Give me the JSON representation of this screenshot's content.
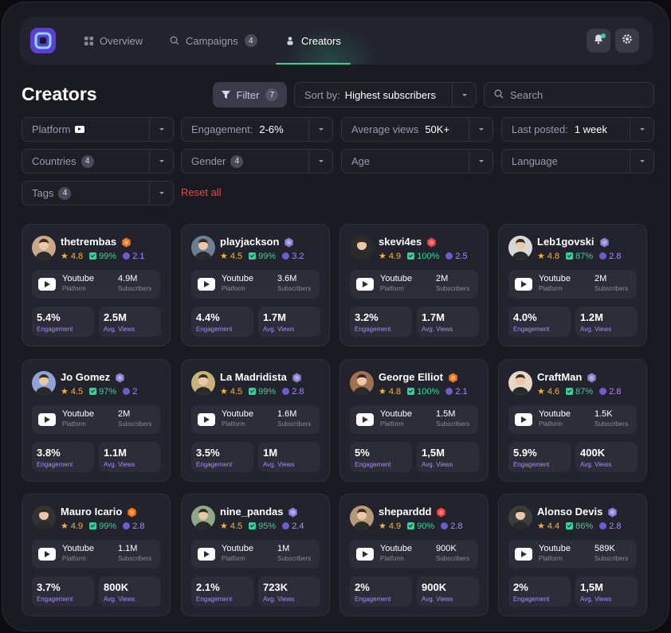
{
  "nav": {
    "tabs": [
      {
        "label": "Overview",
        "icon": "grid-icon"
      },
      {
        "label": "Campaigns",
        "count": "4",
        "icon": "search-icon"
      },
      {
        "label": "Creators",
        "icon": "creators-icon",
        "active": true
      }
    ],
    "accent": "#34d399"
  },
  "page_title": "Creators",
  "toolbar": {
    "filter_label": "Filter",
    "filter_count": "7",
    "sort_label": "Sort by:",
    "sort_value": "Highest subscribers",
    "search_placeholder": "Search"
  },
  "filters": [
    {
      "label": "Platform",
      "value": ""
    },
    {
      "label": "Engagement:",
      "value": "2-6%"
    },
    {
      "label": "Average views",
      "value": "50K+"
    },
    {
      "label": "Last posted:",
      "value": "1 week"
    },
    {
      "label": "Countries",
      "count": "4"
    },
    {
      "label": "Gender",
      "count": "4"
    },
    {
      "label": "Age"
    },
    {
      "label": "Language"
    },
    {
      "label": "Tags",
      "count": "4"
    }
  ],
  "reset_label": "Reset all",
  "labels": {
    "platform": "Platform",
    "subscribers": "Subscribers",
    "engagement": "Engagement",
    "avg_views": "Avg. Views"
  },
  "creators": [
    {
      "name": "thetrembas",
      "badge": "orange",
      "rating": "4.8",
      "pct": "99%",
      "coins": "2.1",
      "platform": "Youtube",
      "subscribers": "4.9M",
      "engagement": "5.4%",
      "views": "2.5M"
    },
    {
      "name": "playjackson",
      "badge": "purple",
      "rating": "4.5",
      "pct": "99%",
      "coins": "3.2",
      "platform": "Youtube",
      "subscribers": "3.6M",
      "engagement": "4.4%",
      "views": "1.7M"
    },
    {
      "name": "skevi4es",
      "badge": "red",
      "rating": "4.9",
      "pct": "100%",
      "coins": "2.5",
      "platform": "Youtube",
      "subscribers": "2M",
      "engagement": "3.2%",
      "views": "1.7M"
    },
    {
      "name": "Leb1govski",
      "badge": "purple",
      "rating": "4.8",
      "pct": "87%",
      "coins": "2.8",
      "platform": "Youtube",
      "subscribers": "2M",
      "engagement": "4.0%",
      "views": "1.2M"
    },
    {
      "name": "Jo Gomez",
      "badge": "purple",
      "rating": "4.5",
      "pct": "97%",
      "coins": "2",
      "platform": "Youtube",
      "subscribers": "2M",
      "engagement": "3.8%",
      "views": "1.1M"
    },
    {
      "name": "La Madridista",
      "badge": "purple",
      "rating": "4.5",
      "pct": "99%",
      "coins": "2.8",
      "platform": "Youtube",
      "subscribers": "1.6M",
      "engagement": "3.5%",
      "views": "1M"
    },
    {
      "name": "George Elliot",
      "badge": "orange",
      "rating": "4.8",
      "pct": "100%",
      "coins": "2.1",
      "platform": "Youtube",
      "subscribers": "1.5M",
      "engagement": "5%",
      "views": "1,5M"
    },
    {
      "name": "CraftMan",
      "badge": "purple",
      "rating": "4.6",
      "pct": "87%",
      "coins": "2.8",
      "platform": "Youtube",
      "subscribers": "1.5K",
      "engagement": "5.9%",
      "views": "400K"
    },
    {
      "name": "Mauro Icario",
      "badge": "orange",
      "rating": "4.9",
      "pct": "99%",
      "coins": "2.8",
      "platform": "Youtube",
      "subscribers": "1.1M",
      "engagement": "3.7%",
      "views": "800K"
    },
    {
      "name": "nine_pandas",
      "badge": "purple",
      "rating": "4.5",
      "pct": "95%",
      "coins": "2.4",
      "platform": "Youtube",
      "subscribers": "1M",
      "engagement": "2.1%",
      "views": "723K"
    },
    {
      "name": "sheparddd",
      "badge": "red",
      "rating": "4.9",
      "pct": "90%",
      "coins": "2.8",
      "platform": "Youtube",
      "subscribers": "900K",
      "engagement": "2%",
      "views": "900K"
    },
    {
      "name": "Alonso Devis",
      "badge": "purple",
      "rating": "4.4",
      "pct": "86%",
      "coins": "2.8",
      "platform": "Youtube",
      "subscribers": "589K",
      "engagement": "2%",
      "views": "1,5M"
    }
  ],
  "colors": {
    "rating": "#f5b43a",
    "percent": "#34d399",
    "coins": "#a78bfa",
    "reset": "#ef4444",
    "badge_orange": "#f97316",
    "badge_purple": "#8b7fd6",
    "badge_red": "#ef4444"
  }
}
